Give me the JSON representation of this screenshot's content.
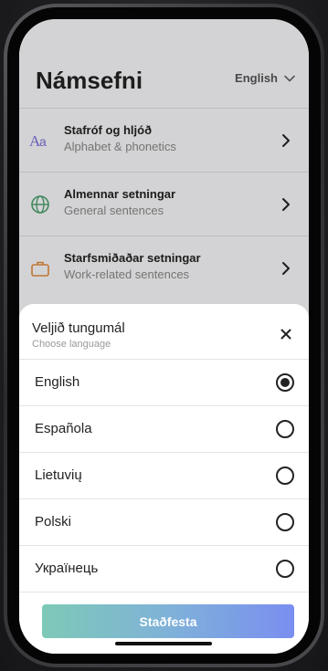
{
  "header": {
    "title": "Námsefni",
    "language": "English"
  },
  "topics": [
    {
      "title": "Stafróf og hljóð",
      "subtitle": "Alphabet & phonetics",
      "icon": "alphabet-icon"
    },
    {
      "title": "Almennar setningar",
      "subtitle": "General sentences",
      "icon": "globe-icon"
    },
    {
      "title": "Starfsmiðaðar setningar",
      "subtitle": "Work-related sentences",
      "icon": "briefcase-icon"
    }
  ],
  "sheet": {
    "title": "Veljið tungumál",
    "subtitle": "Choose language",
    "options": [
      {
        "label": "English",
        "selected": true
      },
      {
        "label": "Española",
        "selected": false
      },
      {
        "label": "Lietuvių",
        "selected": false
      },
      {
        "label": "Polski",
        "selected": false
      },
      {
        "label": "Українець",
        "selected": false
      }
    ],
    "confirm_label": "Staðfesta"
  },
  "colors": {
    "gradient_start": "#7ec9b7",
    "gradient_end": "#7a8ef0",
    "alphabet_icon": "#7b6fd6",
    "globe_icon": "#4e9f6e",
    "briefcase_icon": "#e08a3c"
  }
}
